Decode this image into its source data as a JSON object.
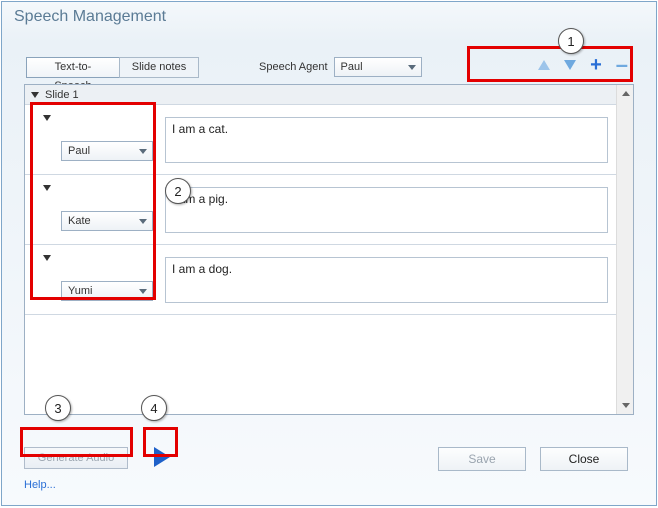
{
  "window": {
    "title": "Speech Management"
  },
  "tabs": {
    "tts": "Text-to-Speech",
    "notes": "Slide notes"
  },
  "agent": {
    "label": "Speech Agent",
    "value": "Paul"
  },
  "slide": {
    "header": "Slide 1"
  },
  "entries": [
    {
      "voice": "Paul",
      "text": "I am a cat."
    },
    {
      "voice": "Kate",
      "text": "I am a pig."
    },
    {
      "voice": "Yumi",
      "text": "I am a dog."
    }
  ],
  "buttons": {
    "generate": "Generate Audio",
    "save": "Save",
    "close": "Close",
    "help": "Help..."
  },
  "annotations": {
    "b1": "1",
    "b2": "2",
    "b3": "3",
    "b4": "4"
  }
}
